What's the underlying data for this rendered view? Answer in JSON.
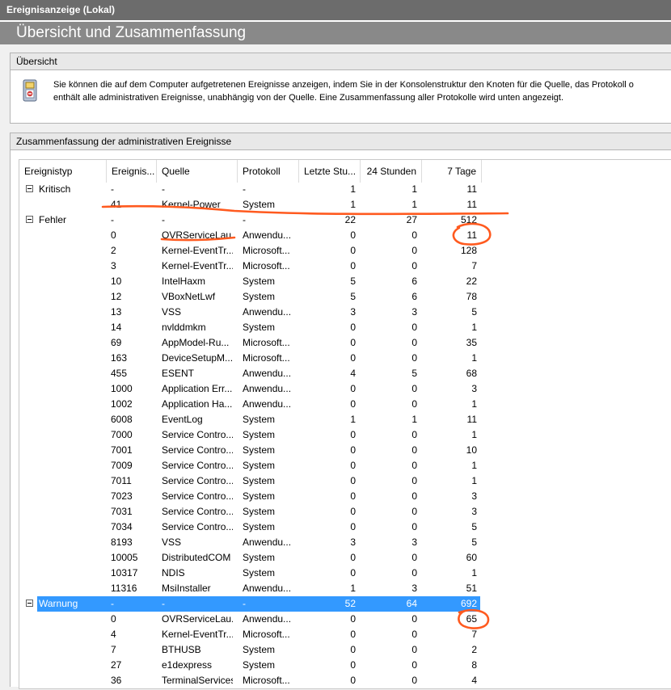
{
  "window": {
    "title": "Ereignisanzeige (Lokal)"
  },
  "header": {
    "title": "Übersicht und Zusammenfassung"
  },
  "overview": {
    "heading": "Übersicht",
    "icon": "event-log-icon",
    "line1": "Sie können die auf dem Computer aufgetretenen Ereignisse anzeigen, indem Sie in der Konsolenstruktur den Knoten für die Quelle, das Protokoll o",
    "line2": "enthält alle administrativen Ereignisse, unabhängig von der Quelle. Eine Zusammenfassung aller Protokolle wird unten angezeigt."
  },
  "summary": {
    "heading": "Zusammenfassung der administrativen Ereignisse",
    "columns": [
      "Ereignistyp",
      "Ereignis...",
      "Quelle",
      "Protokoll",
      "Letzte Stu...",
      "24 Stunden",
      "7 Tage"
    ],
    "rows": [
      {
        "type": "Kritisch",
        "group": true,
        "id": "-",
        "source": "-",
        "log": "-",
        "hour": "1",
        "day": "1",
        "week": "11"
      },
      {
        "type": "",
        "id": "41",
        "source": "Kernel-Power",
        "log": "System",
        "hour": "1",
        "day": "1",
        "week": "11"
      },
      {
        "type": "Fehler",
        "group": true,
        "id": "-",
        "source": "-",
        "log": "-",
        "hour": "22",
        "day": "27",
        "week": "512"
      },
      {
        "type": "",
        "id": "0",
        "source": "OVRServiceLau...",
        "log": "Anwendu...",
        "hour": "0",
        "day": "0",
        "week": "11"
      },
      {
        "type": "",
        "id": "2",
        "source": "Kernel-EventTr...",
        "log": "Microsoft...",
        "hour": "0",
        "day": "0",
        "week": "128"
      },
      {
        "type": "",
        "id": "3",
        "source": "Kernel-EventTr...",
        "log": "Microsoft...",
        "hour": "0",
        "day": "0",
        "week": "7"
      },
      {
        "type": "",
        "id": "10",
        "source": "IntelHaxm",
        "log": "System",
        "hour": "5",
        "day": "6",
        "week": "22"
      },
      {
        "type": "",
        "id": "12",
        "source": "VBoxNetLwf",
        "log": "System",
        "hour": "5",
        "day": "6",
        "week": "78"
      },
      {
        "type": "",
        "id": "13",
        "source": "VSS",
        "log": "Anwendu...",
        "hour": "3",
        "day": "3",
        "week": "5"
      },
      {
        "type": "",
        "id": "14",
        "source": "nvlddmkm",
        "log": "System",
        "hour": "0",
        "day": "0",
        "week": "1"
      },
      {
        "type": "",
        "id": "69",
        "source": "AppModel-Ru...",
        "log": "Microsoft...",
        "hour": "0",
        "day": "0",
        "week": "35"
      },
      {
        "type": "",
        "id": "163",
        "source": "DeviceSetupM...",
        "log": "Microsoft...",
        "hour": "0",
        "day": "0",
        "week": "1"
      },
      {
        "type": "",
        "id": "455",
        "source": "ESENT",
        "log": "Anwendu...",
        "hour": "4",
        "day": "5",
        "week": "68"
      },
      {
        "type": "",
        "id": "1000",
        "source": "Application Err...",
        "log": "Anwendu...",
        "hour": "0",
        "day": "0",
        "week": "3"
      },
      {
        "type": "",
        "id": "1002",
        "source": "Application Ha...",
        "log": "Anwendu...",
        "hour": "0",
        "day": "0",
        "week": "1"
      },
      {
        "type": "",
        "id": "6008",
        "source": "EventLog",
        "log": "System",
        "hour": "1",
        "day": "1",
        "week": "11"
      },
      {
        "type": "",
        "id": "7000",
        "source": "Service Contro...",
        "log": "System",
        "hour": "0",
        "day": "0",
        "week": "1"
      },
      {
        "type": "",
        "id": "7001",
        "source": "Service Contro...",
        "log": "System",
        "hour": "0",
        "day": "0",
        "week": "10"
      },
      {
        "type": "",
        "id": "7009",
        "source": "Service Contro...",
        "log": "System",
        "hour": "0",
        "day": "0",
        "week": "1"
      },
      {
        "type": "",
        "id": "7011",
        "source": "Service Contro...",
        "log": "System",
        "hour": "0",
        "day": "0",
        "week": "1"
      },
      {
        "type": "",
        "id": "7023",
        "source": "Service Contro...",
        "log": "System",
        "hour": "0",
        "day": "0",
        "week": "3"
      },
      {
        "type": "",
        "id": "7031",
        "source": "Service Contro...",
        "log": "System",
        "hour": "0",
        "day": "0",
        "week": "3"
      },
      {
        "type": "",
        "id": "7034",
        "source": "Service Contro...",
        "log": "System",
        "hour": "0",
        "day": "0",
        "week": "5"
      },
      {
        "type": "",
        "id": "8193",
        "source": "VSS",
        "log": "Anwendu...",
        "hour": "3",
        "day": "3",
        "week": "5"
      },
      {
        "type": "",
        "id": "10005",
        "source": "DistributedCOM",
        "log": "System",
        "hour": "0",
        "day": "0",
        "week": "60"
      },
      {
        "type": "",
        "id": "10317",
        "source": "NDIS",
        "log": "System",
        "hour": "0",
        "day": "0",
        "week": "1"
      },
      {
        "type": "",
        "id": "11316",
        "source": "MsiInstaller",
        "log": "Anwendu...",
        "hour": "1",
        "day": "3",
        "week": "51"
      },
      {
        "type": "Warnung",
        "group": true,
        "selected": true,
        "id": "-",
        "source": "-",
        "log": "-",
        "hour": "52",
        "day": "64",
        "week": "692"
      },
      {
        "type": "",
        "id": "0",
        "source": "OVRServiceLau...",
        "log": "Anwendu...",
        "hour": "0",
        "day": "0",
        "week": "65"
      },
      {
        "type": "",
        "id": "4",
        "source": "Kernel-EventTr...",
        "log": "Microsoft...",
        "hour": "0",
        "day": "0",
        "week": "7"
      },
      {
        "type": "",
        "id": "7",
        "source": "BTHUSB",
        "log": "System",
        "hour": "0",
        "day": "0",
        "week": "2"
      },
      {
        "type": "",
        "id": "27",
        "source": "e1dexpress",
        "log": "System",
        "hour": "0",
        "day": "0",
        "week": "8"
      },
      {
        "type": "",
        "id": "36",
        "source": "TerminalServices...",
        "log": "Microsoft...",
        "hour": "0",
        "day": "0",
        "week": "4"
      }
    ]
  },
  "colors": {
    "titlebar": "#6c6c6c",
    "header": "#898989",
    "selection": "#3399ff",
    "annotation": "#ff5a1f"
  }
}
